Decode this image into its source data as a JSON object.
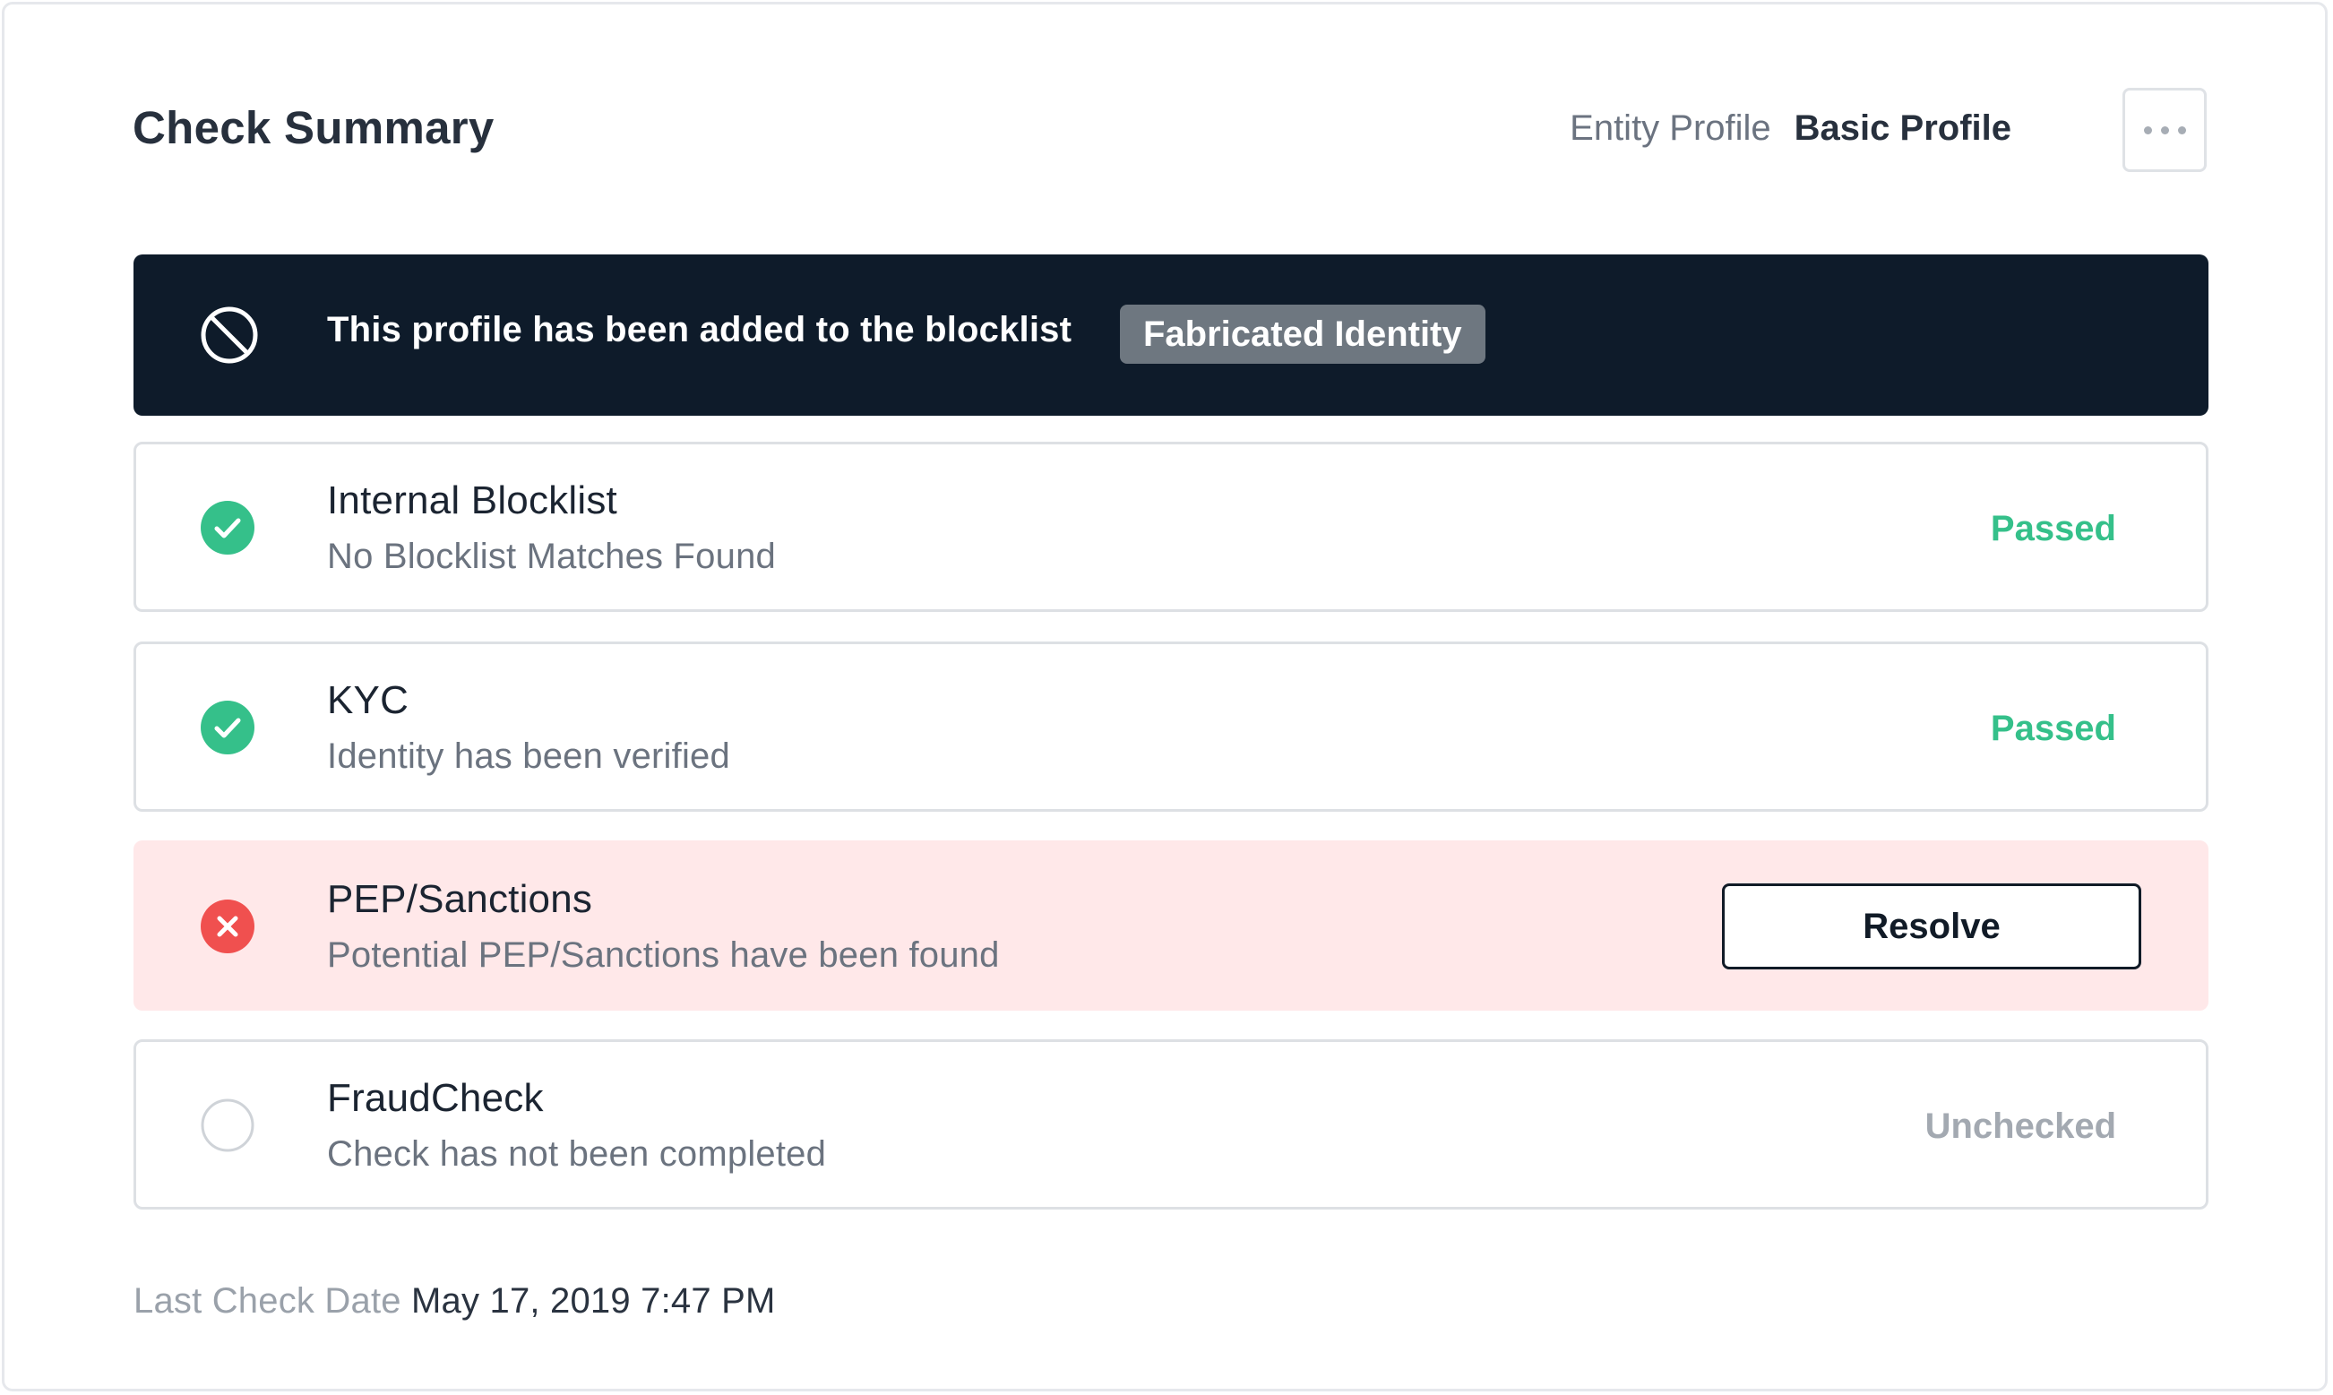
{
  "header": {
    "title": "Check Summary",
    "entity_profile_label": "Entity Profile",
    "basic_profile_label": "Basic Profile",
    "more_icon": "more-horizontal-icon"
  },
  "banner": {
    "icon": "block-icon",
    "message": "This profile has been added to the blocklist",
    "tag": "Fabricated Identity"
  },
  "checks": [
    {
      "name": "Internal Blocklist",
      "description": "No Blocklist Matches Found",
      "status": "Passed",
      "icon": "check-circle-icon"
    },
    {
      "name": "KYC",
      "description": "Identity has been verified",
      "status": "Passed",
      "icon": "check-circle-icon"
    },
    {
      "name": "PEP/Sanctions",
      "description": "Potential PEP/Sanctions have been found",
      "action_label": "Resolve",
      "icon": "x-circle-icon"
    },
    {
      "name": "FraudCheck",
      "description": "Check has not been completed",
      "status": "Unchecked",
      "icon": "empty-circle-icon"
    }
  ],
  "footer": {
    "label": "Last Check Date",
    "value": "May 17, 2019 7:47 PM"
  },
  "colors": {
    "banner_bg": "#0e1b2a",
    "tag_bg": "#6e7780",
    "passed": "#35c08a",
    "failed_icon": "#f0504f",
    "failed_row_bg": "#ffe8e9",
    "unchecked": "#a3a9b1"
  }
}
